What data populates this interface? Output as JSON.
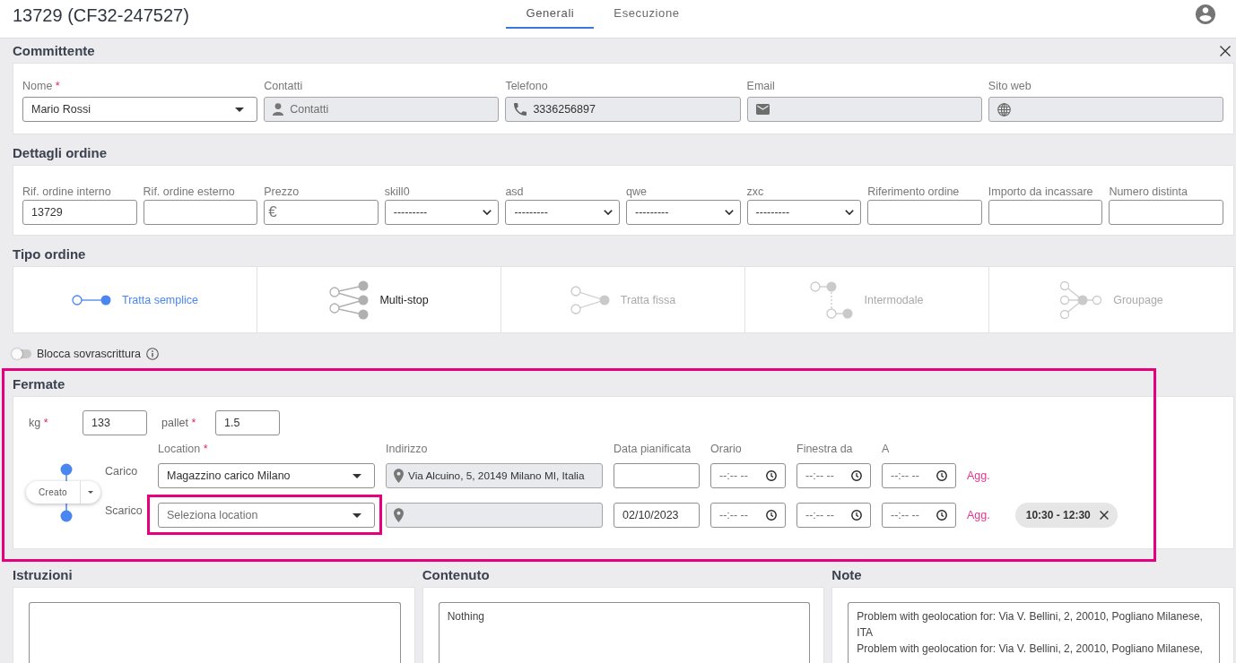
{
  "header": {
    "title": "13729 (CF32-247527)",
    "tabs": [
      {
        "label": "Generali",
        "selected": true
      },
      {
        "label": "Esecuzione",
        "selected": false
      }
    ]
  },
  "committente": {
    "title": "Committente",
    "fields": [
      {
        "kind": "select",
        "label": "Nome",
        "required_mark": "*",
        "value": "Mario Rossi",
        "disabled": false
      },
      {
        "kind": "contact",
        "label": "Contatti",
        "placeholder": "Contatti",
        "disabled": true
      },
      {
        "kind": "phone",
        "label": "Telefono",
        "value": "3336256897",
        "disabled": true
      },
      {
        "kind": "email",
        "label": "Email",
        "disabled": true
      },
      {
        "kind": "web",
        "label": "Sito web",
        "disabled": true
      }
    ]
  },
  "dettagli_ordine": {
    "title": "Dettagli ordine",
    "fields": [
      {
        "kind": "text",
        "label": "Rif. ordine interno",
        "value": "13729"
      },
      {
        "kind": "text",
        "label": "Rif. ordine esterno"
      },
      {
        "kind": "price",
        "label": "Prezzo",
        "prefix": "€"
      },
      {
        "kind": "dropdown",
        "label": "skill0",
        "value": "---------"
      },
      {
        "kind": "dropdown",
        "label": "asd",
        "value": "---------"
      },
      {
        "kind": "dropdown",
        "label": "qwe",
        "value": "---------"
      },
      {
        "kind": "dropdown",
        "label": "zxc",
        "value": "---------"
      },
      {
        "kind": "text",
        "label": "Riferimento ordine"
      },
      {
        "kind": "text",
        "label": "Importo da incassare"
      },
      {
        "kind": "text",
        "label": "Numero distinta"
      }
    ]
  },
  "tipo_ordine": {
    "title": "Tipo ordine",
    "options": [
      {
        "kind": "simple",
        "label": "Tratta semplice",
        "selected": true,
        "disabled": false
      },
      {
        "kind": "multistop",
        "label": "Multi-stop",
        "selected": false,
        "disabled": false
      },
      {
        "kind": "fixed",
        "label": "Tratta fissa",
        "selected": false,
        "disabled": true
      },
      {
        "kind": "intermodal",
        "label": "Intermodale",
        "selected": false,
        "disabled": true
      },
      {
        "kind": "groupage",
        "label": "Groupage",
        "selected": false,
        "disabled": true
      }
    ]
  },
  "lock_toggle": {
    "label": "Blocca sovrascrittura",
    "on": false
  },
  "fermate": {
    "title": "Fermate",
    "highlighted": true,
    "kg": {
      "label": "kg",
      "required_mark": "*",
      "value": "133"
    },
    "pallet": {
      "label": "pallet",
      "required_mark": "*",
      "value": "1.5"
    },
    "status": "Creato",
    "columns": [
      {
        "label": "Location",
        "required_mark": "*"
      },
      {
        "label": "Indirizzo"
      },
      {
        "label": "Data pianificata"
      },
      {
        "label": "Orario"
      },
      {
        "label": "Finestra da"
      },
      {
        "label": "A"
      }
    ],
    "stops": [
      {
        "type": "Carico",
        "location": {
          "value": "Magazzino carico Milano",
          "highlighted": false
        },
        "address": {
          "value": "Via Alcuino, 5, 20149 Milano MI, Italia",
          "disabled": true
        },
        "times": [
          {
            "placeholder": "--:-- --"
          },
          {
            "placeholder": "--:-- --"
          },
          {
            "placeholder": "--:-- --"
          }
        ],
        "add": "Agg."
      },
      {
        "type": "Scarico",
        "location": {
          "placeholder": "Seleziona location",
          "highlighted": true
        },
        "address": {
          "disabled": true
        },
        "date": "02/10/2023",
        "times": [
          {
            "placeholder": "--:-- --"
          },
          {
            "placeholder": "--:-- --"
          },
          {
            "placeholder": "--:-- --"
          }
        ],
        "add": "Agg.",
        "chips": [
          {
            "label": "10:30 - 12:30"
          }
        ]
      }
    ]
  },
  "text_areas": [
    {
      "title": "Istruzioni"
    },
    {
      "title": "Contenuto",
      "value": "Nothing"
    },
    {
      "title": "Note",
      "value": "Problem with geolocation for: Via V. Bellini, 2, 20010, Pogliano Milanese, ITA\nProblem with geolocation for: Via V. Bellini, 2, 20010, Pogliano Milanese,"
    }
  ]
}
